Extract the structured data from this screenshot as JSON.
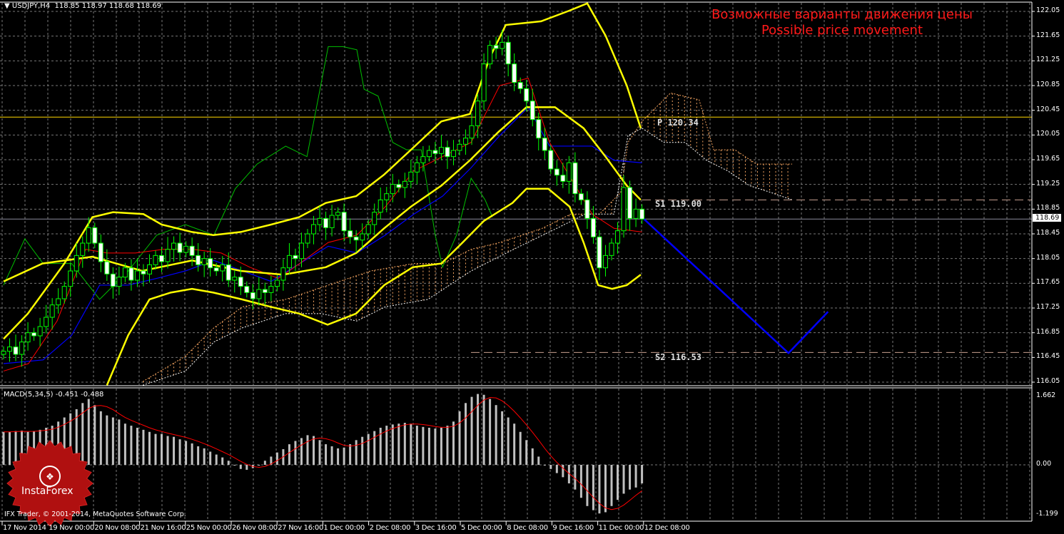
{
  "header": {
    "symbol_label": "USDJPY,H4",
    "ohlc_label": "118.85 118.97 118.68 118.69",
    "macd_label": "MACD(5,34,5) -0.451 -0.488",
    "copyright": "IFX Trader, © 2001-2014, MetaQuotes Software Corp.",
    "logo": "InstaForex"
  },
  "annotation": {
    "title_ru": "Возможные варианты движения цены",
    "title_en": "Possible price movement"
  },
  "colors": {
    "background": "#000000",
    "candle": "#00ff00",
    "bb": "#ffff00",
    "tenkan": "#ff0000",
    "kijun": "#0000ff",
    "chikou": "#00c000",
    "cloud_a": "#f4a460",
    "cloud_b": "#ffffff",
    "forecast": "#0000ff",
    "pivot": "#ffd700",
    "support": "#c8a090",
    "macd_hist": "#c0c0c0",
    "macd_signal": "#ff0000"
  },
  "chart_data": {
    "type": "line",
    "title": "USDJPY,H4",
    "price_axis": {
      "range": [
        116.05,
        122.05
      ],
      "ticks": [
        "122.05",
        "121.65",
        "121.25",
        "120.85",
        "120.45",
        "120.05",
        "119.65",
        "119.25",
        "118.85",
        "118.45",
        "118.05",
        "117.65",
        "117.25",
        "116.85",
        "116.45",
        "116.05"
      ],
      "current": "118.69"
    },
    "macd_axis": {
      "range": [
        -1.199,
        1.662
      ],
      "ticks": [
        "1.662",
        "0.00",
        "-1.199"
      ]
    },
    "time_labels": [
      "17 Nov 2014",
      "19 Nov 00:00",
      "20 Nov 08:00",
      "21 Nov 16:00",
      "25 Nov 00:00",
      "26 Nov 08:00",
      "27 Nov 16:00",
      "1 Dec 00:00",
      "2 Dec 08:00",
      "3 Dec 16:00",
      "5 Dec 00:00",
      "8 Dec 08:00",
      "9 Dec 16:00",
      "11 Dec 00:00",
      "12 Dec 08:00"
    ],
    "closes": [
      116.55,
      116.62,
      116.5,
      116.7,
      116.85,
      116.8,
      116.95,
      117.1,
      117.3,
      117.4,
      117.6,
      117.85,
      118.1,
      118.3,
      118.55,
      118.3,
      118.0,
      117.8,
      117.6,
      117.75,
      117.9,
      117.7,
      117.85,
      117.8,
      117.95,
      118.1,
      118.0,
      118.2,
      118.3,
      118.15,
      118.25,
      118.1,
      117.95,
      118.05,
      117.9,
      117.85,
      117.95,
      117.7,
      117.75,
      117.6,
      117.5,
      117.4,
      117.55,
      117.5,
      117.6,
      117.7,
      117.9,
      118.1,
      118.05,
      118.3,
      118.45,
      118.6,
      118.7,
      118.55,
      118.75,
      118.8,
      118.5,
      118.4,
      118.35,
      118.45,
      118.6,
      118.8,
      119.0,
      119.1,
      119.25,
      119.2,
      119.3,
      119.45,
      119.6,
      119.7,
      119.8,
      119.75,
      119.85,
      119.7,
      119.8,
      119.9,
      120.0,
      120.2,
      120.6,
      121.2,
      121.5,
      121.45,
      121.55,
      121.2,
      120.9,
      120.8,
      120.6,
      120.3,
      120.0,
      119.8,
      119.5,
      119.4,
      119.3,
      119.6,
      119.1,
      119.0,
      118.7,
      118.4,
      117.9,
      118.1,
      118.3,
      118.5,
      119.2,
      118.7,
      118.85,
      118.69
    ],
    "bb_upper": [
      [
        0,
        116.75
      ],
      [
        4,
        117.16
      ],
      [
        10,
        117.97
      ],
      [
        14.6,
        118.72
      ],
      [
        18,
        118.8
      ],
      [
        23,
        118.77
      ],
      [
        26,
        118.6
      ],
      [
        31,
        118.48
      ],
      [
        34.5,
        118.43
      ],
      [
        39,
        118.48
      ],
      [
        44,
        118.6
      ],
      [
        48.6,
        118.72
      ],
      [
        53,
        118.95
      ],
      [
        58,
        119.06
      ],
      [
        62.6,
        119.41
      ],
      [
        67,
        119.81
      ],
      [
        72,
        120.27
      ],
      [
        76.7,
        120.39
      ],
      [
        80,
        121.31
      ],
      [
        82.6,
        121.83
      ],
      [
        88.4,
        121.89
      ],
      [
        93,
        122.06
      ],
      [
        96,
        122.18
      ],
      [
        99,
        121.66
      ],
      [
        102.5,
        120.85
      ],
      [
        104.8,
        120.16
      ]
    ],
    "bb_middle": [
      [
        0,
        117.68
      ],
      [
        6.4,
        117.97
      ],
      [
        14.6,
        118.08
      ],
      [
        22.8,
        117.85
      ],
      [
        31,
        118.02
      ],
      [
        39,
        117.85
      ],
      [
        46,
        117.79
      ],
      [
        53,
        117.91
      ],
      [
        58,
        118.14
      ],
      [
        62.6,
        118.54
      ],
      [
        67,
        118.89
      ],
      [
        72,
        119.23
      ],
      [
        76.7,
        119.64
      ],
      [
        81.4,
        120.1
      ],
      [
        86,
        120.5
      ],
      [
        90.7,
        120.5
      ],
      [
        95.4,
        120.16
      ],
      [
        99,
        119.7
      ],
      [
        102.5,
        119.23
      ],
      [
        104.8,
        119.0
      ]
    ],
    "bb_lower": [
      [
        17,
        116.0
      ],
      [
        20.5,
        116.81
      ],
      [
        24,
        117.39
      ],
      [
        27.5,
        117.5
      ],
      [
        31,
        117.56
      ],
      [
        34.5,
        117.5
      ],
      [
        39.2,
        117.39
      ],
      [
        43.9,
        117.27
      ],
      [
        48.6,
        117.16
      ],
      [
        53.3,
        116.98
      ],
      [
        58,
        117.16
      ],
      [
        62.6,
        117.62
      ],
      [
        67.3,
        117.91
      ],
      [
        72,
        117.97
      ],
      [
        75.5,
        118.31
      ],
      [
        79,
        118.66
      ],
      [
        83.7,
        118.95
      ],
      [
        86,
        119.18
      ],
      [
        89.6,
        119.18
      ],
      [
        93.1,
        118.89
      ],
      [
        95.4,
        118.31
      ],
      [
        97.8,
        117.62
      ],
      [
        100.1,
        117.56
      ],
      [
        102.5,
        117.62
      ],
      [
        104.8,
        117.79
      ]
    ],
    "tenkan": [
      [
        0,
        116.23
      ],
      [
        4.1,
        116.35
      ],
      [
        8.8,
        117.04
      ],
      [
        13.5,
        118.2
      ],
      [
        17,
        118.14
      ],
      [
        21.7,
        118.14
      ],
      [
        26.4,
        118.2
      ],
      [
        31.1,
        118.2
      ],
      [
        35.8,
        118.14
      ],
      [
        40.5,
        117.91
      ],
      [
        45.2,
        117.73
      ],
      [
        48.7,
        117.97
      ],
      [
        53.4,
        118.31
      ],
      [
        58.1,
        118.43
      ],
      [
        62.8,
        118.89
      ],
      [
        67.5,
        119.47
      ],
      [
        72.2,
        119.7
      ],
      [
        76.9,
        119.93
      ],
      [
        81.6,
        120.85
      ],
      [
        86.3,
        120.97
      ],
      [
        89.8,
        119.93
      ],
      [
        93.3,
        119.35
      ],
      [
        96.8,
        118.77
      ],
      [
        100.4,
        118.54
      ],
      [
        105,
        118.48
      ]
    ],
    "kijun": [
      [
        0,
        116.35
      ],
      [
        6.5,
        116.41
      ],
      [
        11.2,
        116.81
      ],
      [
        15.8,
        117.62
      ],
      [
        20.5,
        117.62
      ],
      [
        25.2,
        117.73
      ],
      [
        29.9,
        117.85
      ],
      [
        34.6,
        118.02
      ],
      [
        39.3,
        117.85
      ],
      [
        44,
        117.68
      ],
      [
        48.7,
        117.97
      ],
      [
        53.4,
        118.25
      ],
      [
        58.1,
        118.14
      ],
      [
        62.8,
        118.43
      ],
      [
        67.5,
        118.77
      ],
      [
        72.2,
        119.06
      ],
      [
        76.9,
        119.52
      ],
      [
        81.6,
        120.04
      ],
      [
        86.3,
        120.5
      ],
      [
        89.8,
        119.87
      ],
      [
        96.8,
        119.87
      ],
      [
        100.4,
        119.64
      ],
      [
        105,
        119.6
      ]
    ],
    "chikou": [
      [
        0,
        117.62
      ],
      [
        3.5,
        118.37
      ],
      [
        6.5,
        117.97
      ],
      [
        11.2,
        117.97
      ],
      [
        15.8,
        117.39
      ],
      [
        20.5,
        117.85
      ],
      [
        25.2,
        118.43
      ],
      [
        29.9,
        118.6
      ],
      [
        34.6,
        118.43
      ],
      [
        38.1,
        119.18
      ],
      [
        41.7,
        119.58
      ],
      [
        46.4,
        119.87
      ],
      [
        49.9,
        119.7
      ],
      [
        53.4,
        121.48
      ],
      [
        55.8,
        121.48
      ],
      [
        58.1,
        121.43
      ],
      [
        59.3,
        120.79
      ],
      [
        61.6,
        120.68
      ],
      [
        64,
        119.93
      ],
      [
        66.3,
        119.81
      ],
      [
        68.7,
        119.81
      ],
      [
        71,
        118.43
      ],
      [
        72.2,
        117.91
      ],
      [
        74.5,
        118.43
      ],
      [
        76.9,
        119.35
      ],
      [
        79.2,
        119.0
      ],
      [
        80.4,
        118.72
      ]
    ],
    "span_a": [
      [
        22.9,
        116.06
      ],
      [
        29.9,
        116.47
      ],
      [
        34.6,
        116.93
      ],
      [
        39.3,
        117.27
      ],
      [
        46.4,
        117.39
      ],
      [
        53.4,
        117.62
      ],
      [
        60.4,
        117.85
      ],
      [
        67.5,
        117.97
      ],
      [
        72.2,
        117.97
      ],
      [
        76.9,
        118.2
      ],
      [
        81.6,
        118.31
      ],
      [
        88.6,
        118.54
      ],
      [
        93.3,
        118.77
      ],
      [
        98,
        118.77
      ],
      [
        101.5,
        119.12
      ],
      [
        102.7,
        119.93
      ],
      [
        105,
        120.27
      ],
      [
        109.7,
        120.73
      ],
      [
        114.4,
        120.62
      ],
      [
        116.8,
        119.81
      ],
      [
        120.3,
        119.81
      ],
      [
        123.8,
        119.58
      ],
      [
        129.7,
        119.58
      ]
    ],
    "span_b": [
      [
        22.9,
        116.0
      ],
      [
        29.9,
        116.23
      ],
      [
        34.6,
        116.7
      ],
      [
        39.3,
        116.93
      ],
      [
        46.4,
        117.16
      ],
      [
        52.2,
        117.16
      ],
      [
        58.1,
        117.04
      ],
      [
        62.8,
        117.27
      ],
      [
        69.8,
        117.39
      ],
      [
        76.9,
        117.85
      ],
      [
        83.9,
        118.2
      ],
      [
        91,
        118.54
      ],
      [
        95.7,
        118.77
      ],
      [
        100.4,
        118.77
      ],
      [
        102.7,
        120.04
      ],
      [
        105,
        120.16
      ],
      [
        108.6,
        119.93
      ],
      [
        112.1,
        119.93
      ],
      [
        115.6,
        119.64
      ],
      [
        119.1,
        119.47
      ],
      [
        122.7,
        119.23
      ],
      [
        126.2,
        119.12
      ],
      [
        129.7,
        119.0
      ]
    ],
    "forecast": [
      [
        105,
        118.72
      ],
      [
        129.1,
        116.52
      ],
      [
        135.6,
        117.19
      ]
    ],
    "levels": [
      {
        "label": "P 120.34",
        "price": 120.34,
        "style": "solid"
      },
      {
        "label": "S1 119.00",
        "price": 119.0,
        "style": "dashed"
      },
      {
        "label": "S2 116.53",
        "price": 116.53,
        "style": "dashed"
      }
    ],
    "macd_hist": [
      0.8,
      0.8,
      0.82,
      0.83,
      0.8,
      0.82,
      0.85,
      0.9,
      0.95,
      1.05,
      1.15,
      1.25,
      1.35,
      1.5,
      1.6,
      1.45,
      1.3,
      1.2,
      1.15,
      1.1,
      1.0,
      0.95,
      0.9,
      0.85,
      0.8,
      0.75,
      0.75,
      0.7,
      0.68,
      0.62,
      0.58,
      0.52,
      0.45,
      0.4,
      0.32,
      0.25,
      0.18,
      0.1,
      0.0,
      -0.1,
      -0.12,
      -0.08,
      0.0,
      0.1,
      0.2,
      0.3,
      0.38,
      0.5,
      0.58,
      0.65,
      0.72,
      0.7,
      0.6,
      0.5,
      0.45,
      0.4,
      0.42,
      0.5,
      0.6,
      0.68,
      0.75,
      0.82,
      0.9,
      0.95,
      0.98,
      1.0,
      1.02,
      1.0,
      0.95,
      0.92,
      0.9,
      0.88,
      0.9,
      0.95,
      1.05,
      1.3,
      1.5,
      1.65,
      1.72,
      1.7,
      1.6,
      1.45,
      1.3,
      1.15,
      1.0,
      0.8,
      0.6,
      0.4,
      0.2,
      0.0,
      -0.1,
      -0.2,
      -0.3,
      -0.45,
      -0.6,
      -0.8,
      -1.0,
      -1.1,
      -1.18,
      -1.15,
      -1.0,
      -0.85,
      -0.7,
      -0.6,
      -0.55,
      -0.45
    ]
  }
}
